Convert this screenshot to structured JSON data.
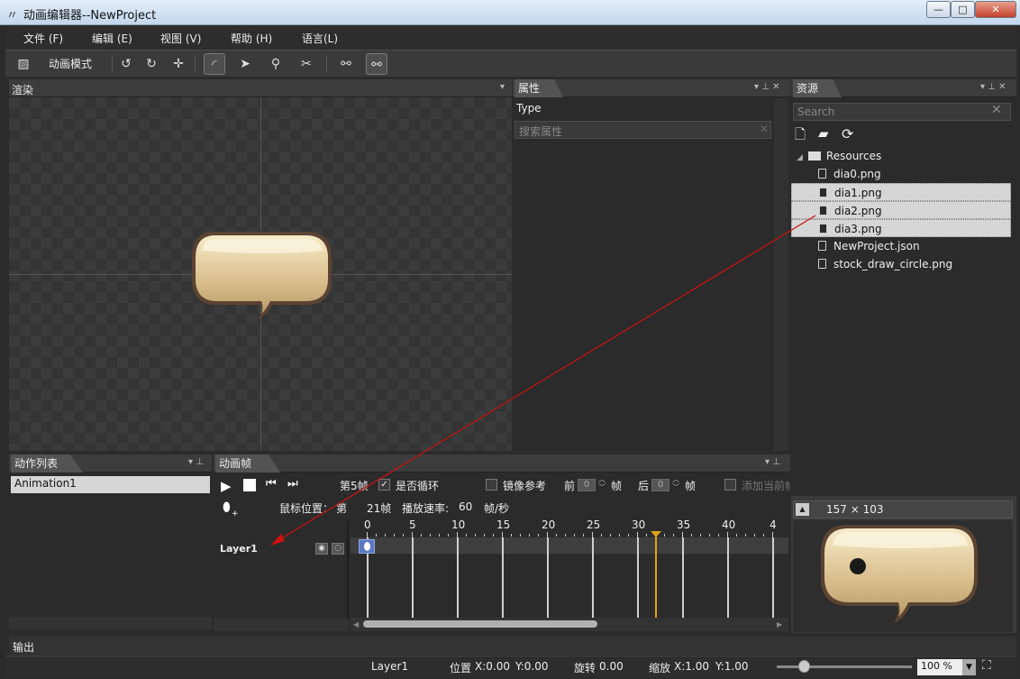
{
  "window": {
    "title": "动画编辑器--NewProject",
    "minimize": "—",
    "maximize": "□",
    "close": "✕"
  },
  "menu": [
    "文件 (F)",
    "编辑 (E)",
    "视图 (V)",
    "帮助 (H)",
    "语言(L)"
  ],
  "toolbar": {
    "mode": "动画模式"
  },
  "render": {
    "tab": "渲染"
  },
  "properties": {
    "tab": "属性",
    "type_label": "Type",
    "search_placeholder": "搜索属性"
  },
  "resources": {
    "tab": "资源",
    "search_placeholder": "Search",
    "root": "Resources",
    "files": [
      "dia0.png",
      "dia1.png",
      "dia2.png",
      "dia3.png",
      "NewProject.json",
      "stock_draw_circle.png"
    ],
    "selected": [
      "dia1.png",
      "dia2.png",
      "dia3.png"
    ],
    "preview_size": "157  ×  103"
  },
  "action_list": {
    "tab": "动作列表",
    "items": [
      "Animation1"
    ]
  },
  "frames": {
    "tab": "动画帧",
    "current_frame": "第5帧",
    "loop_label": "是否循环",
    "loop_checked": true,
    "mirror_label": "镜像参考",
    "before_label": "前",
    "before_value": "0",
    "before_unit": "帧",
    "after_label": "后",
    "after_value": "0",
    "after_unit": "帧",
    "add_current_label": "添加当前帧",
    "mouse_pos_label": "鼠标位置：",
    "mouse_pos_prefix": "第",
    "mouse_pos_value": "21帧",
    "fps_label": "播放速率:",
    "fps_value": "60",
    "fps_unit": "帧/秒",
    "ruler": [
      "0",
      "5",
      "10",
      "15",
      "20",
      "25",
      "30",
      "35",
      "40",
      "4"
    ],
    "layer": "Layer1",
    "keyframe": 0,
    "playhead": 32
  },
  "output": {
    "label": "输出"
  },
  "status": {
    "layer": "Layer1",
    "position_label": "位置",
    "x": "X:0.00",
    "y": "Y:0.00",
    "rotation_label": "旋转",
    "rotation": "0.00",
    "scale_label": "缩放",
    "scale_x": "X:1.00",
    "scale_y": "Y:1.00",
    "zoom": "100 %"
  },
  "colors": {
    "accent": "#e0a21a",
    "drag_arrow": "#cc1111",
    "keyframe": "#5b78c4"
  }
}
